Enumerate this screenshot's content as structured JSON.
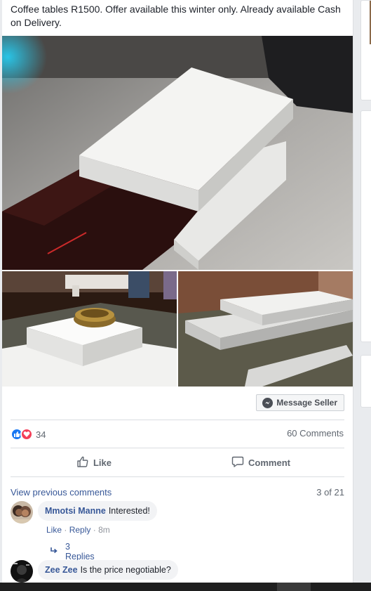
{
  "post": {
    "text": "Coffee tables R1500. Offer available this winter only. Already available Cash on Delivery.",
    "message_seller_label": "Message Seller"
  },
  "reactions": {
    "count": "34",
    "comments_label": "60 Comments"
  },
  "actions": {
    "like_label": "Like",
    "comment_label": "Comment"
  },
  "comments": {
    "view_previous_label": "View previous comments",
    "page_count": "3 of 21",
    "items": [
      {
        "author": "Mmotsi Manne",
        "text": "Interested!",
        "like_label": "Like",
        "reply_label": "Reply",
        "time": "8m",
        "replies_label": "3 Replies"
      },
      {
        "author": "Zee Zee",
        "text": "Is the price negotiable?"
      }
    ]
  },
  "colors": {
    "link": "#385898",
    "like_blue": "#1877f2",
    "love_red": "#f33e58",
    "bubble_bg": "#f2f3f5"
  }
}
